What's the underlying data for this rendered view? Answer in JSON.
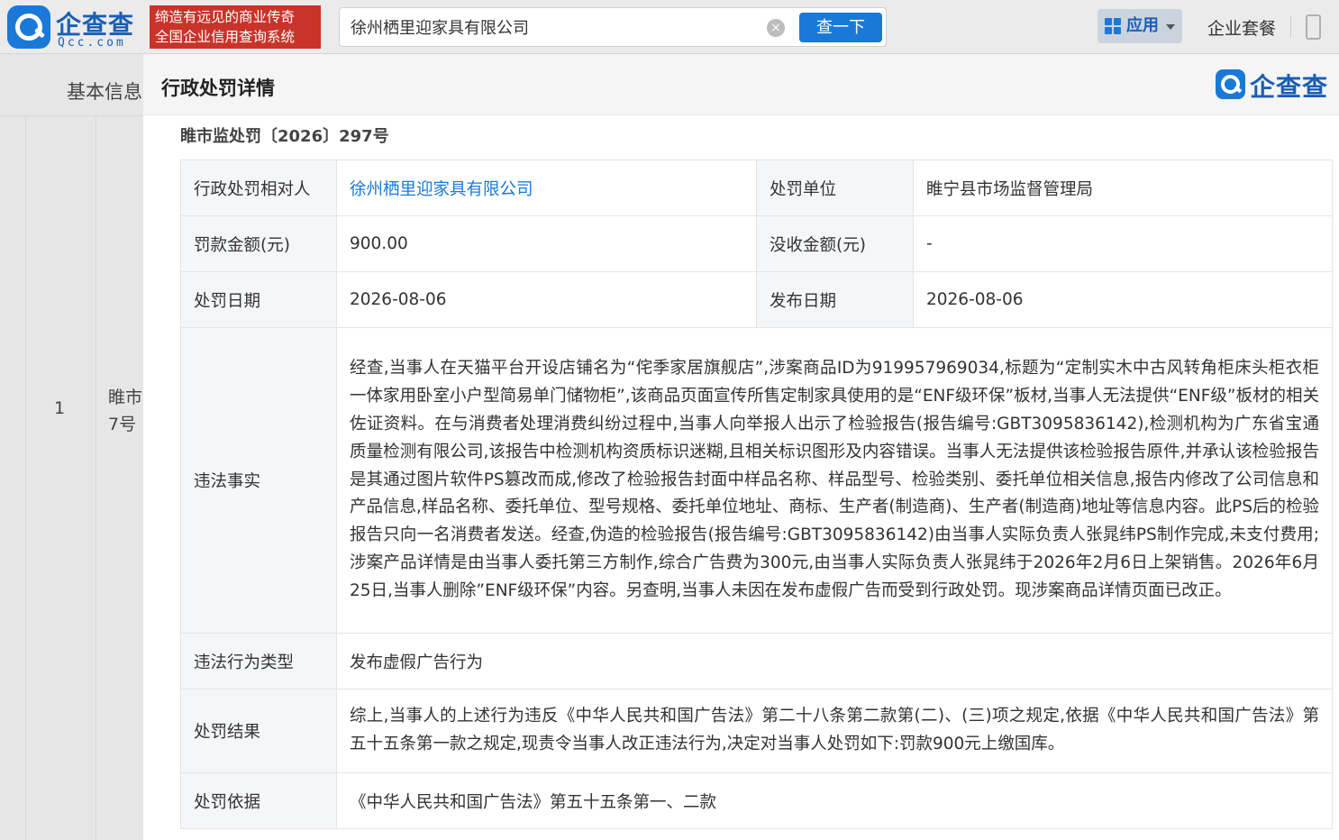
{
  "header": {
    "logo_text": "企查查",
    "logo_sub": "Qcc.com",
    "slogan_line1": "缔造有远见的商业传奇",
    "slogan_line2": "全国企业信用查询系统",
    "search_value": "徐州栖里迎家具有限公司",
    "clear_glyph": "×",
    "search_button": "查一下",
    "apps_label": "应用",
    "package_label": "企业套餐"
  },
  "background": {
    "tab_label": "基本信息",
    "row_index": "1",
    "case_fragment_line1": "睢市",
    "case_fragment_line2": "7号"
  },
  "modal": {
    "title": "行政处罚详情",
    "brand_text": "企查查",
    "case_number": "睢市监处罚〔2026〕297号",
    "rows": {
      "party_label": "行政处罚相对人",
      "party_value": "徐州栖里迎家具有限公司",
      "authority_label": "处罚单位",
      "authority_value": "睢宁县市场监督管理局",
      "fine_label": "罚款金额(元)",
      "fine_value": "900.00",
      "confiscation_label": "没收金额(元)",
      "confiscation_value": "-",
      "penalty_date_label": "处罚日期",
      "penalty_date_value": "2026-08-06",
      "publish_date_label": "发布日期",
      "publish_date_value": "2026-08-06",
      "facts_label": "违法事实",
      "facts_value": "经查,当事人在天猫平台开设店铺名为“侘季家居旗舰店”,涉案商品ID为919957969034,标题为“定制实木中古风转角柜床头柜衣柜一体家用卧室小户型简易单门储物柜”,该商品页面宣传所售定制家具使用的是“ENF级环保”板材,当事人无法提供“ENF级”板材的相关佐证资料。在与消费者处理消费纠纷过程中,当事人向举报人出示了检验报告(报告编号:GBT3095836142),检测机构为广东省宝通质量检测有限公司,该报告中检测机构资质标识迷糊,且相关标识图形及内容错误。当事人无法提供该检验报告原件,并承认该检验报告是其通过图片软件PS篡改而成,修改了检验报告封面中样品名称、样品型号、检验类别、委托单位相关信息,报告内修改了公司信息和产品信息,样品名称、委托单位、型号规格、委托单位地址、商标、生产者(制造商)、生产者(制造商)地址等信息内容。此PS后的检验报告只向一名消费者发送。经查,伪造的检验报告(报告编号:GBT3095836142)由当事人实际负责人张晁纬PS制作完成,未支付费用;涉案产品详情是由当事人委托第三方制作,综合广告费为300元,由当事人实际负责人张晁纬于2026年2月6日上架销售。2026年6月25日,当事人删除”ENF级环保”内容。另查明,当事人未因在发布虚假广告而受到行政处罚。现涉案商品详情页面已改正。",
      "violation_type_label": "违法行为类型",
      "violation_type_value": "发布虚假广告行为",
      "result_label": "处罚结果",
      "result_value": "综上,当事人的上述行为违反《中华人民共和国广告法》第二十八条第二款第(二)、(三)项之规定,依据《中华人民共和国广告法》第五十五条第一款之规定,现责令当事人改正违法行为,决定对当事人处罚如下:罚款900元上缴国库。",
      "basis_label": "处罚依据",
      "basis_value": "《中华人民共和国广告法》第五十五条第一、二款"
    }
  },
  "colors": {
    "brand_blue": "#1a79d8",
    "slogan_red": "#c8342a",
    "link_blue": "#1a79d8"
  }
}
